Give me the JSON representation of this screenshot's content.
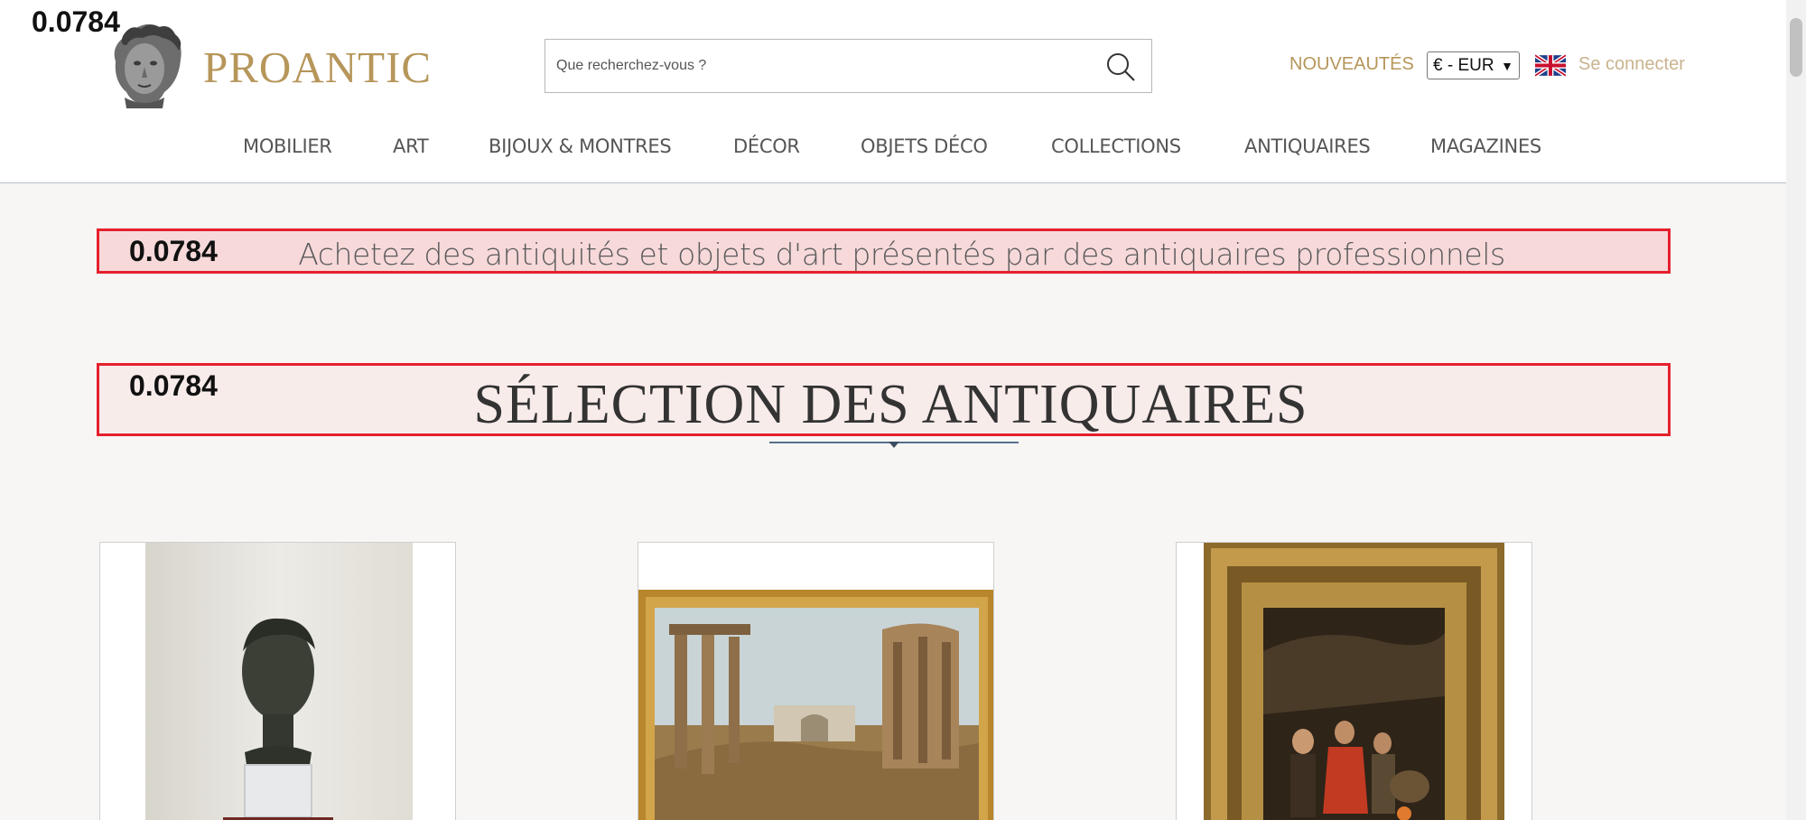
{
  "scores": {
    "top_left": "0.0784",
    "tagline": "0.0784",
    "section": "0.0784"
  },
  "header": {
    "logo_text": "PROANTIC",
    "search": {
      "placeholder": "Que recherchez-vous ?",
      "value": ""
    },
    "nouveautes": "NOUVEAUTÉS",
    "currency": "€ - EUR",
    "login": "Se connecter"
  },
  "nav": {
    "items": [
      {
        "label": "MOBILIER"
      },
      {
        "label": "ART"
      },
      {
        "label": "BIJOUX & MONTRES"
      },
      {
        "label": "DÉCOR"
      },
      {
        "label": "OBJETS DÉCO"
      },
      {
        "label": "COLLECTIONS"
      },
      {
        "label": "ANTIQUAIRES"
      },
      {
        "label": "MAGAZINES"
      }
    ]
  },
  "main": {
    "tagline": "Achetez des antiquités et objets d'art présentés par des antiquaires professionnels",
    "section_title": "SÉLECTION DES ANTIQUAIRES"
  },
  "colors": {
    "gold": "#b6965a",
    "highlight_border": "#e5202d",
    "rule": "#56708b"
  },
  "icons": {
    "search": "search-icon",
    "flag": "uk-flag-icon",
    "logo": "bust-logo-icon"
  }
}
